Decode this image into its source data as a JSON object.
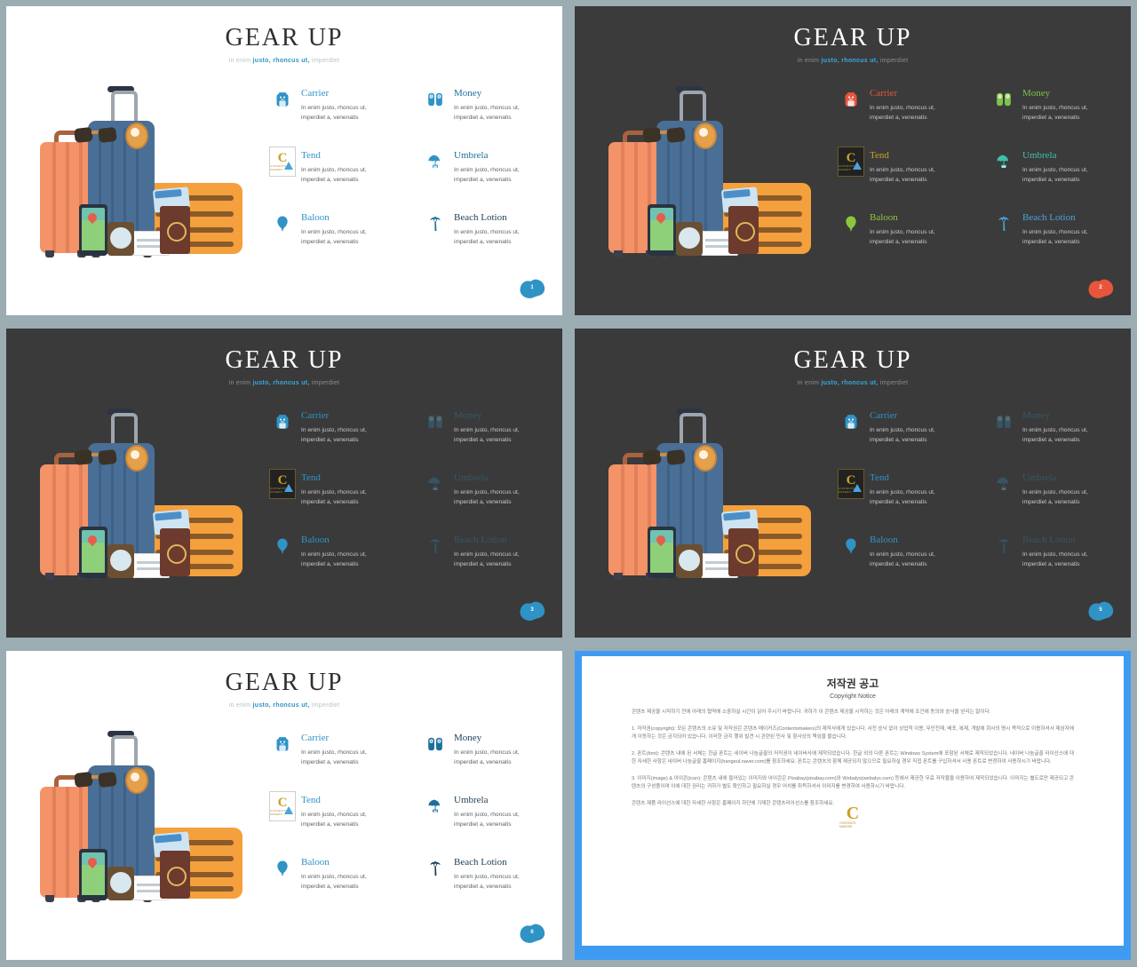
{
  "deck": {
    "title": "GEAR UP",
    "subtitle_pre": "in enim ",
    "subtitle_hl": "justo, rhoncus ut,",
    "subtitle_post": " imperdiet",
    "accent_blue": "#2f93c6",
    "accent_dark_blue": "#1b6f9c",
    "background": "#9bacb3",
    "dark_slide_bg": "#3b3b3b",
    "light_slide_bg": "#ffffff"
  },
  "features": [
    {
      "name": "Carrier",
      "icon": "backpack-icon",
      "desc_line1": "In enim justo, rhoncus ut,",
      "desc_line2": "imperdiet a, venenatis"
    },
    {
      "name": "Money",
      "icon": "money-icon",
      "desc_line1": "In enim justo, rhoncus ut,",
      "desc_line2": "imperdiet a, venenatis"
    },
    {
      "name": "Tend",
      "icon": "tent-logo-icon",
      "desc_line1": "In enim justo, rhoncus ut,",
      "desc_line2": "imperdiet a, venenatis"
    },
    {
      "name": "Umbrela",
      "icon": "umbrella-icon",
      "desc_line1": "In enim justo, rhoncus ut,",
      "desc_line2": "imperdiet a, venenatis"
    },
    {
      "name": "Baloon",
      "icon": "balloon-icon",
      "desc_line1": "In enim justo, rhoncus ut,",
      "desc_line2": "imperdiet a, venenatis"
    },
    {
      "name": "Beach Lotion",
      "icon": "palm-tree-icon",
      "desc_line1": "In enim justo, rhoncus ut,",
      "desc_line2": "imperdiet a, venenatis"
    }
  ],
  "slides": [
    {
      "id": 1,
      "theme": "light",
      "page": "1",
      "colors": [
        "#2f93c6",
        "#2f93c6",
        "#2f93c6",
        "#2f93c6",
        "#2f93c6",
        "#1b6f9c"
      ],
      "name_colors": [
        "#2f93c6",
        "#1d6f9c",
        "#2f93c6",
        "#1d6f9c",
        "#2f93c6",
        "#1d3f55"
      ],
      "dim": [
        false,
        false,
        false,
        false,
        false,
        false
      ]
    },
    {
      "id": 2,
      "theme": "dark",
      "page": "2",
      "colors": [
        "#e8553c",
        "#7fc24a",
        "#c9a227",
        "#3fbfa8",
        "#8cc63f",
        "#4aa3dc"
      ],
      "name_colors": [
        "#e8553c",
        "#7fc24a",
        "#c9a227",
        "#3fbfa8",
        "#8cc63f",
        "#4aa3dc"
      ],
      "dim": [
        false,
        false,
        false,
        false,
        false,
        false
      ]
    },
    {
      "id": 3,
      "theme": "dark",
      "page": "3",
      "colors": [
        "#2f93c6",
        "#2f93c6",
        "#2f93c6",
        "#2f93c6",
        "#2f93c6",
        "#2f93c6"
      ],
      "name_colors": [
        "#2f93c6",
        "#2f93c6",
        "#2f93c6",
        "#2f93c6",
        "#2f93c6",
        "#2f93c6"
      ],
      "dim": [
        false,
        true,
        false,
        true,
        false,
        true
      ]
    },
    {
      "id": 4,
      "theme": "dark",
      "page": "5",
      "colors": [
        "#2f93c6",
        "#2f93c6",
        "#2f93c6",
        "#2f93c6",
        "#2f93c6",
        "#2f93c6"
      ],
      "name_colors": [
        "#2f93c6",
        "#2f93c6",
        "#2f93c6",
        "#2f93c6",
        "#2f93c6",
        "#2f93c6"
      ],
      "dim": [
        false,
        true,
        false,
        true,
        false,
        true
      ]
    },
    {
      "id": 5,
      "theme": "light",
      "page": "6",
      "colors": [
        "#2f93c6",
        "#1d6f9c",
        "#2f93c6",
        "#1d6f9c",
        "#2f93c6",
        "#1d3f55"
      ],
      "name_colors": [
        "#2f93c6",
        "#1d3f55",
        "#2f93c6",
        "#1d3f55",
        "#2f93c6",
        "#1d3f55"
      ],
      "dim": [
        false,
        false,
        false,
        false,
        false,
        false
      ]
    }
  ],
  "copyright": {
    "title": "저작권 공고",
    "subtitle": "Copyright Notice",
    "intro": "콘텐츠 제공을 시작하기 전에 아래의 협약에 소중하실 시간이 읽어 주시기 바랍니다. 귀하가 이 콘텐츠 제공을 시작하는 것은 아래의 계약에 조건에 동의와 승낙을 얻리는 말이다.",
    "p1": "1. 저작권(copyright): 모든 콘텐츠의 소유 및 저작권은 콘텐츠 메이커즈(Contentsmakers)의 제작사에게 있습니다. 사전 승낙 없이 상업적 이용, 무단전재, 배포, 복제, 개발에 회사의 명시 목적으로 이용하셔서 제삼자에게 이동하는 것은 금지되어 있습니다. 이러한 금지 행위 발견 시 관련된 민사 및 형사상의 책임을 물습니다.",
    "p2": "2. 폰트(font): 콘텐츠 내에 된 서체는 한글 폰트는 네이버 나눔글꼴의 저작권이 네이버사에 제작되었습니다. 한글 외의 다른 폰트는 Windows System에 포함된 서체로 제작되었습니다. 네이버 나눔글꼴 라이선스에 대한 자세한 사항은 네이버 나눔글꼴 홈페이지(hangeul.naver.com)를 참조하세요. 폰트는 콘텐츠의 함께 제공되지 않으므로 필요하실 경우 직접 폰트를 구입하셔서 사용 폰트로 변경하여 사용하시기 바랍니다.",
    "p3": "3. 이미지(image) & 아이콘(icon): 콘텐츠 내에 들어있는 이미지와 아이콘은 Pixabay(pixabay.com)와 Webalys(webalys.com) 등에서 제공한 무료 저작물을 이용하여 제작되었습니다. 이미지는 별도로만 제공되고 콘텐츠의 구성품이며 이에 대한 권리는 귀하가 별도 확인하고 필요하실 경우 어치를 취득하셔서 이미지를 변경하여 사용하시기 바랍니다.",
    "p4": "콘텐츠 제품 라이선스에 대한 자세한 사항은 홈페이지 하단에 기재한 콘텐츠라이선스를 참조하세요.",
    "logo_letter": "C",
    "logo_caption": "CONTENTS MAKERS"
  }
}
